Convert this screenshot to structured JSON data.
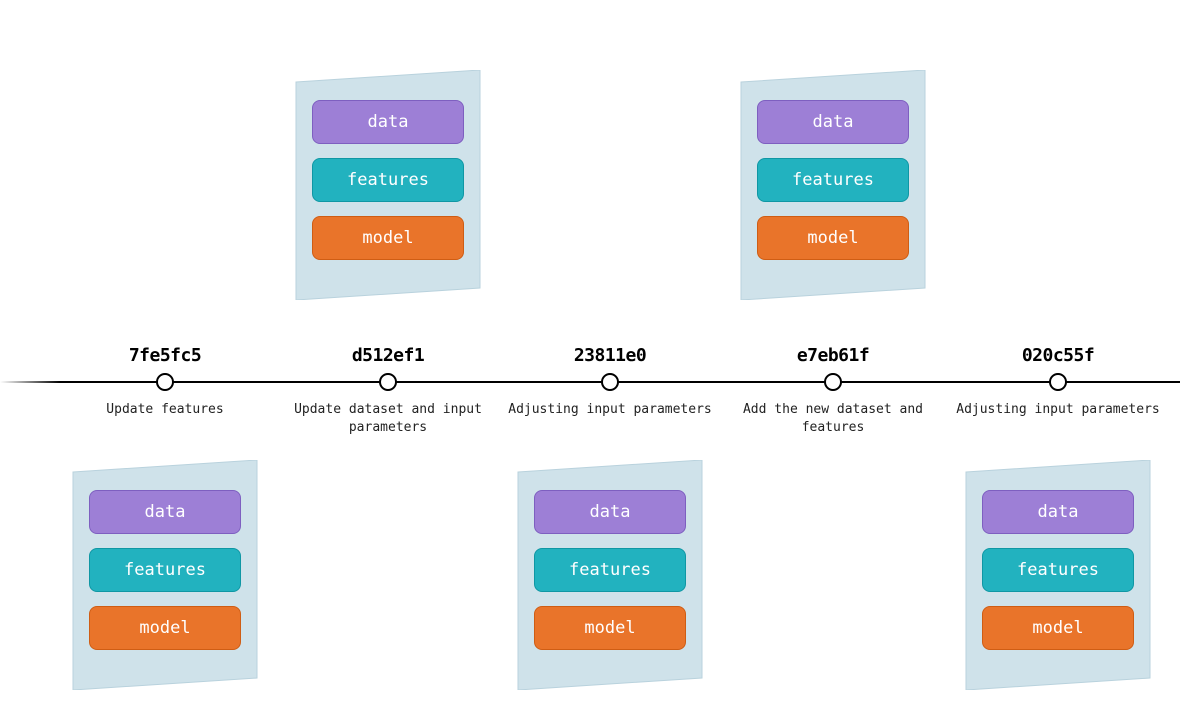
{
  "pill_labels": {
    "data": "data",
    "features": "features",
    "model": "model"
  },
  "commits": [
    {
      "hash": "7fe5fc5",
      "message": "Update features"
    },
    {
      "hash": "d512ef1",
      "message": "Update dataset and input parameters"
    },
    {
      "hash": "23811e0",
      "message": "Adjusting input parameters"
    },
    {
      "hash": "e7eb61f",
      "message": "Add the new dataset and features"
    },
    {
      "hash": "020c55f",
      "message": "Adjusting input parameters"
    }
  ],
  "card_positions": [
    "bottom",
    "top",
    "bottom",
    "top",
    "bottom"
  ]
}
